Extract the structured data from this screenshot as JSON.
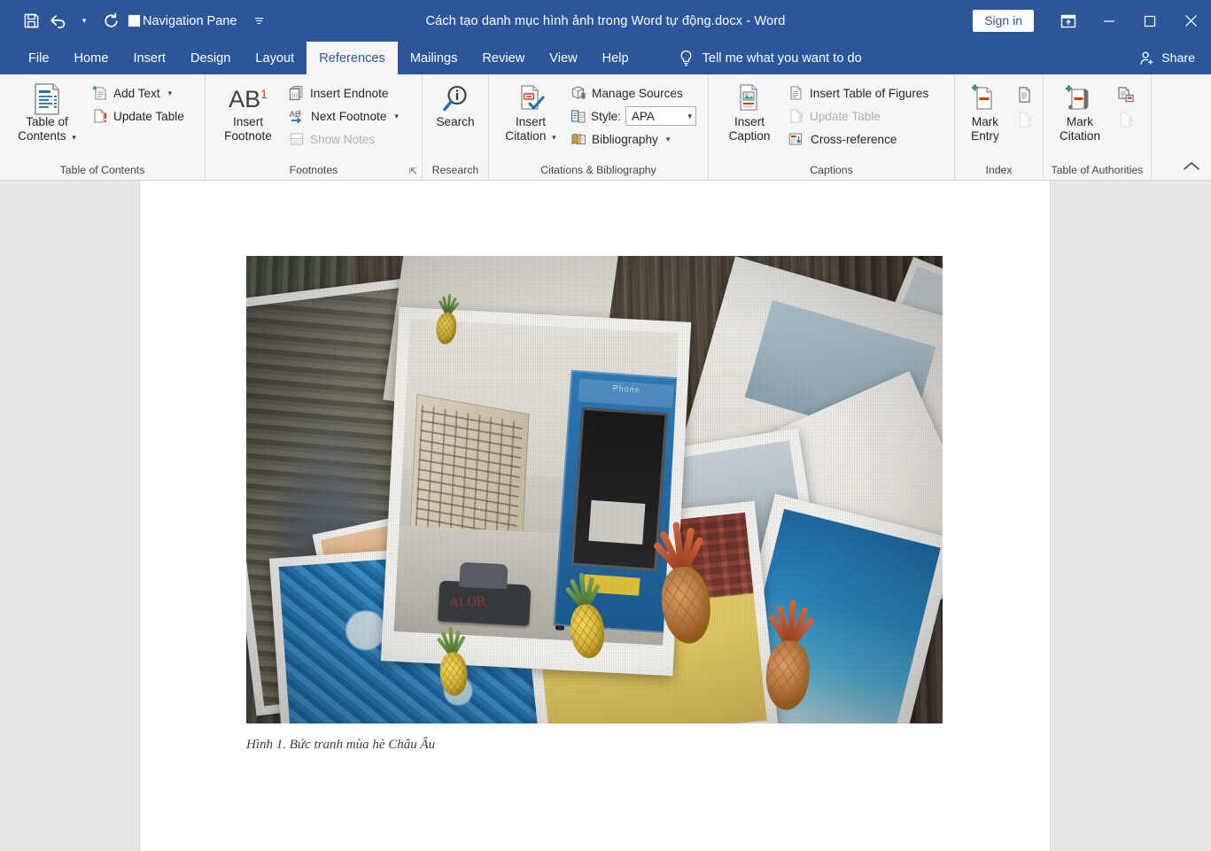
{
  "titlebar": {
    "quick_access": [
      {
        "name": "save",
        "label": "Save",
        "icon": "save-icon"
      },
      {
        "name": "undo",
        "label": "Undo",
        "icon": "undo-icon"
      },
      {
        "name": "redo",
        "label": "Redo",
        "icon": "redo-icon"
      },
      {
        "name": "navigation-pane",
        "label": "Navigation Pane",
        "icon": "checkbox-icon"
      },
      {
        "name": "customize-qat",
        "label": "Customize Quick Access Toolbar",
        "icon": "chevron-down-icon"
      }
    ],
    "document_title": "Cách tạo danh mục hình ảnh trong Word tự động.docx  -  Word",
    "sign_in": "Sign in",
    "ribbon_display_options": "Ribbon Display Options",
    "minimize": "Minimize",
    "maximize": "Restore Down",
    "close": "Close"
  },
  "tabs": [
    {
      "label": "File",
      "active": false
    },
    {
      "label": "Home",
      "active": false
    },
    {
      "label": "Insert",
      "active": false
    },
    {
      "label": "Design",
      "active": false
    },
    {
      "label": "Layout",
      "active": false
    },
    {
      "label": "References",
      "active": true
    },
    {
      "label": "Mailings",
      "active": false
    },
    {
      "label": "Review",
      "active": false
    },
    {
      "label": "View",
      "active": false
    },
    {
      "label": "Help",
      "active": false
    }
  ],
  "tell_me": "Tell me what you want to do",
  "share": "Share",
  "ribbon": {
    "collapse_label": "Collapse the Ribbon",
    "groups": [
      {
        "name": "table-of-contents",
        "title": "Table of Contents",
        "big": {
          "label_line1": "Table of",
          "label_line2": "Contents",
          "has_caret": true
        },
        "small": [
          {
            "label": "Add Text",
            "has_caret": true,
            "disabled": false
          },
          {
            "label": "Update Table",
            "has_caret": false,
            "disabled": false
          }
        ]
      },
      {
        "name": "footnotes",
        "title": "Footnotes",
        "has_dialog_launcher": true,
        "big": {
          "glyph": "AB",
          "sup": "1",
          "label_line1": "Insert",
          "label_line2": "Footnote",
          "has_caret": false
        },
        "small": [
          {
            "label": "Insert Endnote",
            "has_caret": false,
            "disabled": false
          },
          {
            "label": "Next Footnote",
            "has_caret": true,
            "disabled": false
          },
          {
            "label": "Show Notes",
            "has_caret": false,
            "disabled": true
          }
        ]
      },
      {
        "name": "research",
        "title": "Research",
        "big": {
          "label_line1": "Search",
          "label_line2": "",
          "has_caret": false
        }
      },
      {
        "name": "citations-and-bibliography",
        "title": "Citations & Bibliography",
        "big": {
          "label_line1": "Insert",
          "label_line2": "Citation",
          "has_caret": true
        },
        "small": [
          {
            "label": "Manage Sources",
            "has_caret": false,
            "disabled": false
          },
          {
            "label": "Style:",
            "has_caret": false,
            "disabled": false,
            "is_style_row": true
          },
          {
            "label": "Bibliography",
            "has_caret": true,
            "disabled": false
          }
        ],
        "style_value": "APA"
      },
      {
        "name": "captions",
        "title": "Captions",
        "big": {
          "label_line1": "Insert",
          "label_line2": "Caption",
          "has_caret": false
        },
        "small": [
          {
            "label": "Insert Table of Figures",
            "has_caret": false,
            "disabled": false
          },
          {
            "label": "Update Table",
            "has_caret": false,
            "disabled": true
          },
          {
            "label": "Cross-reference",
            "has_caret": false,
            "disabled": false
          }
        ]
      },
      {
        "name": "index",
        "title": "Index",
        "big": {
          "label_line1": "Mark",
          "label_line2": "Entry",
          "has_caret": false
        },
        "icons": [
          {
            "name": "insert-index-icon",
            "disabled": false
          },
          {
            "name": "update-index-icon",
            "disabled": true
          }
        ]
      },
      {
        "name": "table-of-authorities",
        "title": "Table of Authorities",
        "big": {
          "label_line1": "Mark",
          "label_line2": "Citation",
          "has_caret": false
        },
        "icons": [
          {
            "name": "insert-table-of-authorities-icon",
            "disabled": false
          },
          {
            "name": "update-table-of-authorities-icon",
            "disabled": true
          }
        ]
      }
    ]
  },
  "document": {
    "figure_alt": "Photograph of scattered printed photos with pineapples on a wooden surface",
    "caption": "Hình 1. Bức tranh mùa hè Châu Âu",
    "phone_label": "Phone"
  },
  "colors": {
    "word_blue": "#2b579a",
    "ribbon_bg": "#f6f6f6",
    "page_bg": "#ffffff",
    "workspace_bg": "#e6e6e6",
    "accent_red": "#c0392b",
    "accent_green": "#3f8f5b"
  }
}
